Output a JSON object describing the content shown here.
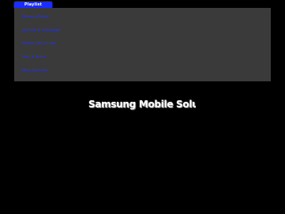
{
  "header": {
    "brand_label": "Playlist"
  },
  "menu": {
    "items": [
      {
        "label": "Phone & Tablet"
      },
      {
        "label": "Camera & Camcorder"
      },
      {
        "label": "Mobile Office Suite"
      },
      {
        "label": "Stay & Share"
      },
      {
        "label": "More Services"
      }
    ]
  },
  "main": {
    "headline": "Samsung Mobile Solutions"
  },
  "colors": {
    "background": "#000000",
    "panel": "#3a3a3a",
    "link": "#2233ff",
    "brand": "#1a2cff",
    "headline": "#ffffff"
  }
}
